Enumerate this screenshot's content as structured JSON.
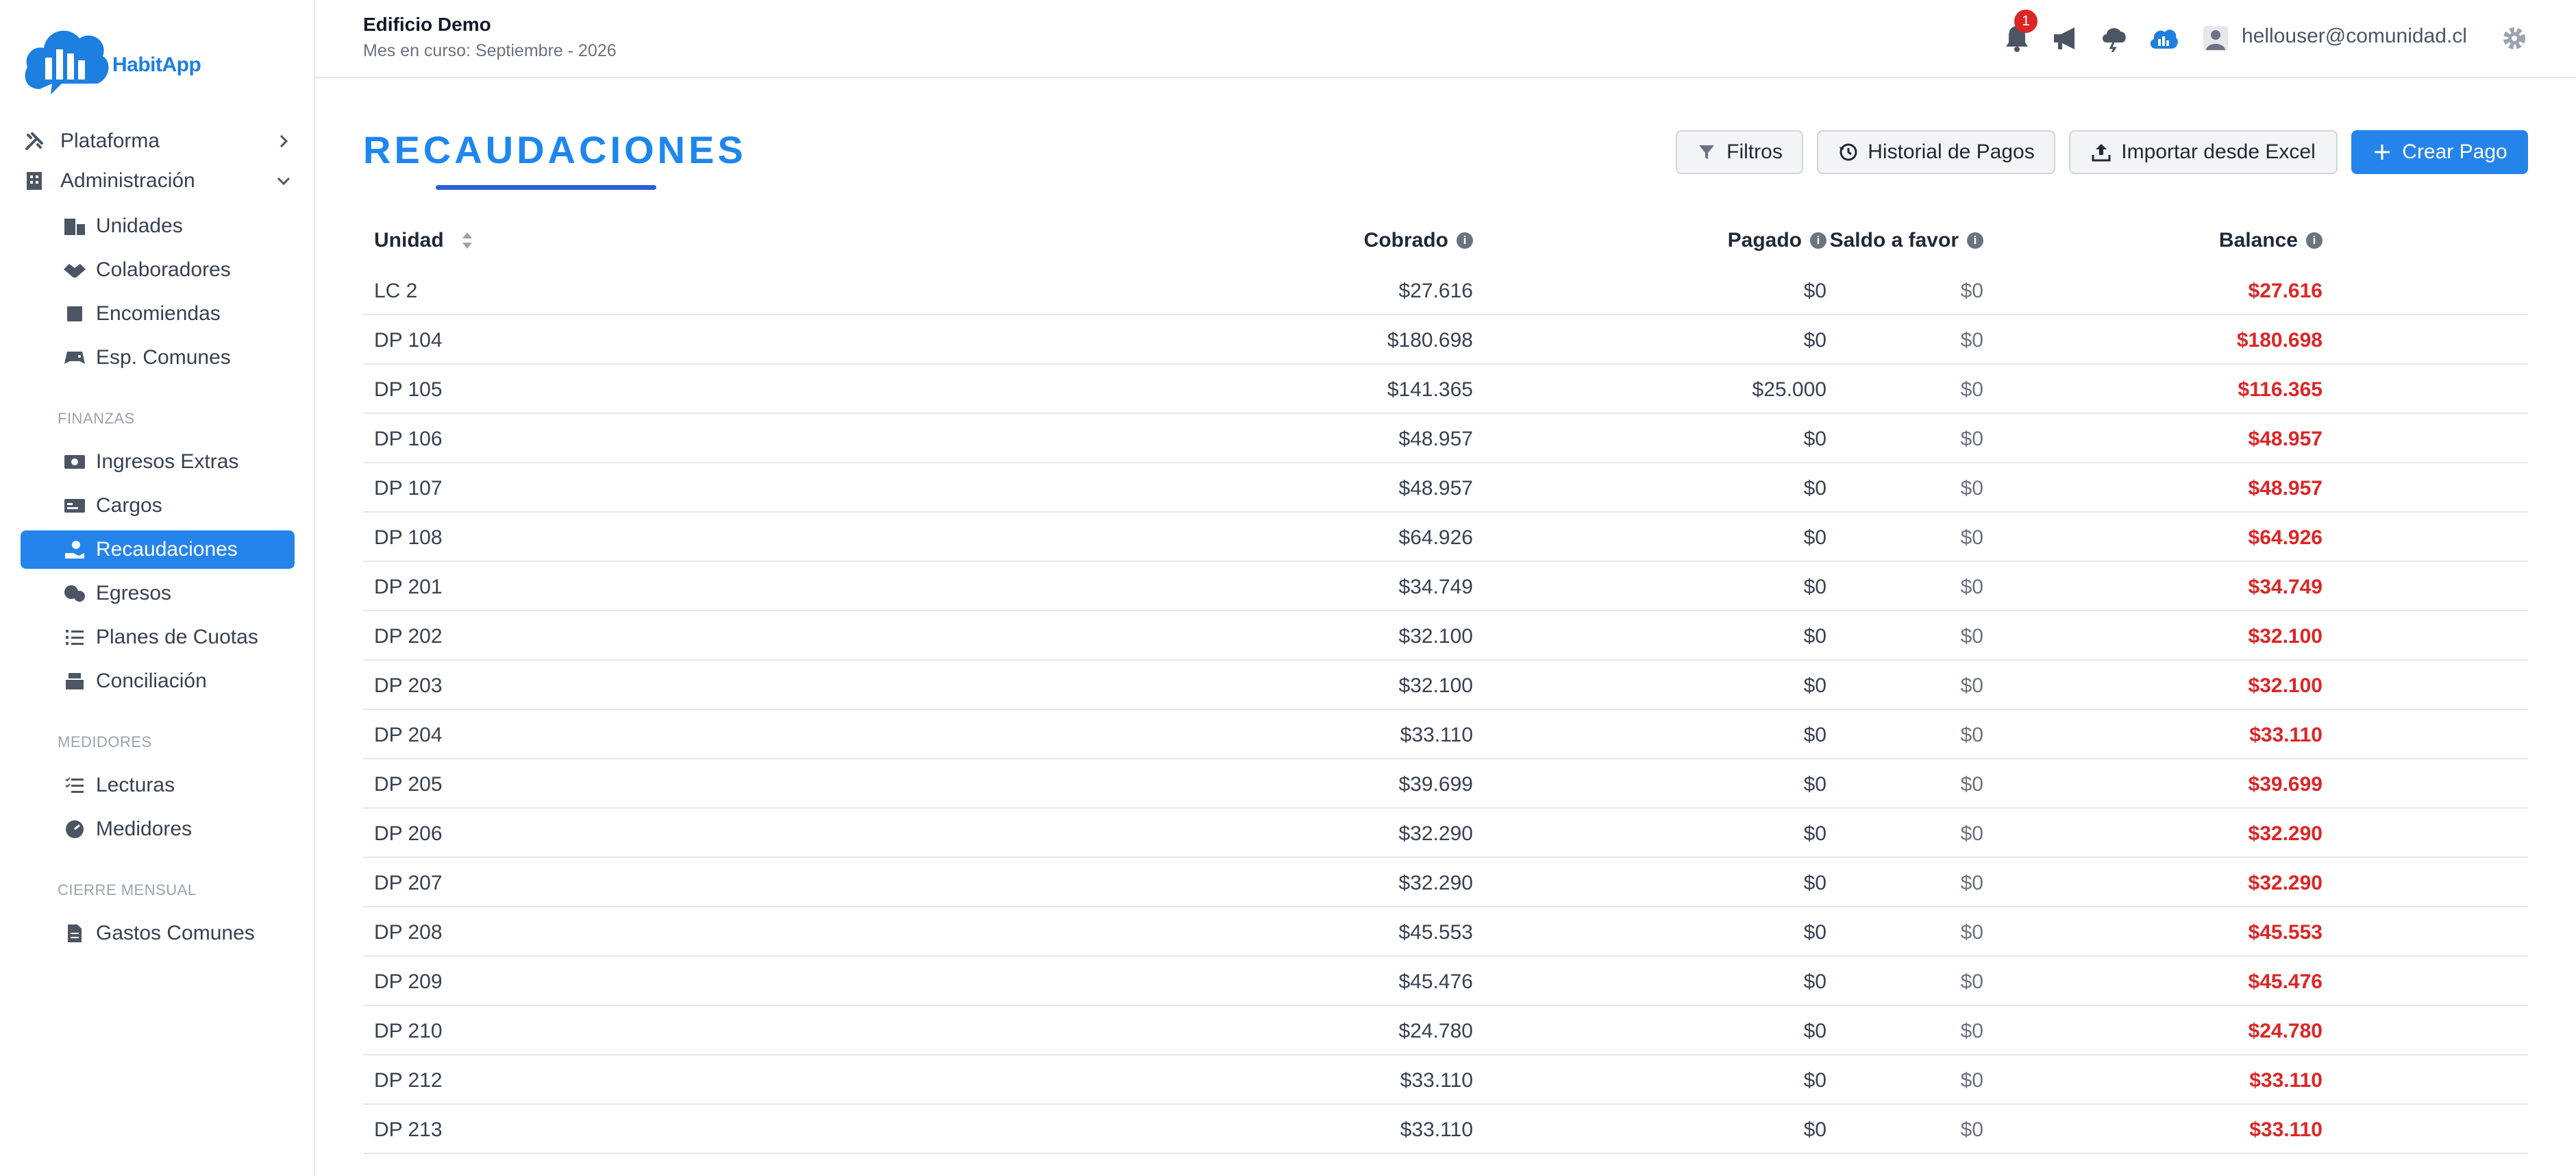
{
  "brand": {
    "name": "HabitApp",
    "color": "#1d7fdf"
  },
  "header": {
    "building": "Edificio Demo",
    "month": "Mes en curso: Septiembre - 2026",
    "notifications_count": "1",
    "user_email": "hellouser@comunidad.cl",
    "icons": [
      "bell-icon",
      "megaphone-icon",
      "cloud-storm-icon",
      "cloud-chart-icon",
      "user-icon",
      "gear-icon"
    ]
  },
  "sidebar": {
    "plataforma": "Plataforma",
    "administracion": "Administración",
    "admin_items": [
      "Unidades",
      "Colaboradores",
      "Encomiendas",
      "Esp. Comunes"
    ],
    "finanzas_title": "FINANZAS",
    "finanzas_items": [
      "Ingresos Extras",
      "Cargos",
      "Recaudaciones",
      "Egresos",
      "Planes de Cuotas",
      "Conciliación"
    ],
    "medidores_title": "MEDIDORES",
    "medidores_items": [
      "Lecturas",
      "Medidores"
    ],
    "cierre_title": "CIERRE MENSUAL",
    "cierre_items": [
      "Gastos Comunes"
    ],
    "active": "Recaudaciones"
  },
  "page": {
    "title": "RECAUDACIONES",
    "buttons": {
      "filtros": "Filtros",
      "historial": "Historial de Pagos",
      "importar": "Importar desde Excel",
      "crear": "Crear Pago"
    }
  },
  "table": {
    "headers": {
      "unidad": "Unidad",
      "cobrado": "Cobrado",
      "pagado": "Pagado",
      "saldo": "Saldo a favor",
      "balance": "Balance"
    },
    "rows": [
      {
        "unidad": "LC 2",
        "cobrado": "$27.616",
        "pagado": "$0",
        "saldo": "$0",
        "balance": "$27.616"
      },
      {
        "unidad": "DP 104",
        "cobrado": "$180.698",
        "pagado": "$0",
        "saldo": "$0",
        "balance": "$180.698"
      },
      {
        "unidad": "DP 105",
        "cobrado": "$141.365",
        "pagado": "$25.000",
        "saldo": "$0",
        "balance": "$116.365"
      },
      {
        "unidad": "DP 106",
        "cobrado": "$48.957",
        "pagado": "$0",
        "saldo": "$0",
        "balance": "$48.957"
      },
      {
        "unidad": "DP 107",
        "cobrado": "$48.957",
        "pagado": "$0",
        "saldo": "$0",
        "balance": "$48.957"
      },
      {
        "unidad": "DP 108",
        "cobrado": "$64.926",
        "pagado": "$0",
        "saldo": "$0",
        "balance": "$64.926"
      },
      {
        "unidad": "DP 201",
        "cobrado": "$34.749",
        "pagado": "$0",
        "saldo": "$0",
        "balance": "$34.749"
      },
      {
        "unidad": "DP 202",
        "cobrado": "$32.100",
        "pagado": "$0",
        "saldo": "$0",
        "balance": "$32.100"
      },
      {
        "unidad": "DP 203",
        "cobrado": "$32.100",
        "pagado": "$0",
        "saldo": "$0",
        "balance": "$32.100"
      },
      {
        "unidad": "DP 204",
        "cobrado": "$33.110",
        "pagado": "$0",
        "saldo": "$0",
        "balance": "$33.110"
      },
      {
        "unidad": "DP 205",
        "cobrado": "$39.699",
        "pagado": "$0",
        "saldo": "$0",
        "balance": "$39.699"
      },
      {
        "unidad": "DP 206",
        "cobrado": "$32.290",
        "pagado": "$0",
        "saldo": "$0",
        "balance": "$32.290"
      },
      {
        "unidad": "DP 207",
        "cobrado": "$32.290",
        "pagado": "$0",
        "saldo": "$0",
        "balance": "$32.290"
      },
      {
        "unidad": "DP 208",
        "cobrado": "$45.553",
        "pagado": "$0",
        "saldo": "$0",
        "balance": "$45.553"
      },
      {
        "unidad": "DP 209",
        "cobrado": "$45.476",
        "pagado": "$0",
        "saldo": "$0",
        "balance": "$45.476"
      },
      {
        "unidad": "DP 210",
        "cobrado": "$24.780",
        "pagado": "$0",
        "saldo": "$0",
        "balance": "$24.780"
      },
      {
        "unidad": "DP 212",
        "cobrado": "$33.110",
        "pagado": "$0",
        "saldo": "$0",
        "balance": "$33.110"
      },
      {
        "unidad": "DP 213",
        "cobrado": "$33.110",
        "pagado": "$0",
        "saldo": "$0",
        "balance": "$33.110"
      }
    ]
  },
  "colors": {
    "accent": "#2584ea",
    "negative": "#dc2626",
    "badge": "#dc2626"
  }
}
